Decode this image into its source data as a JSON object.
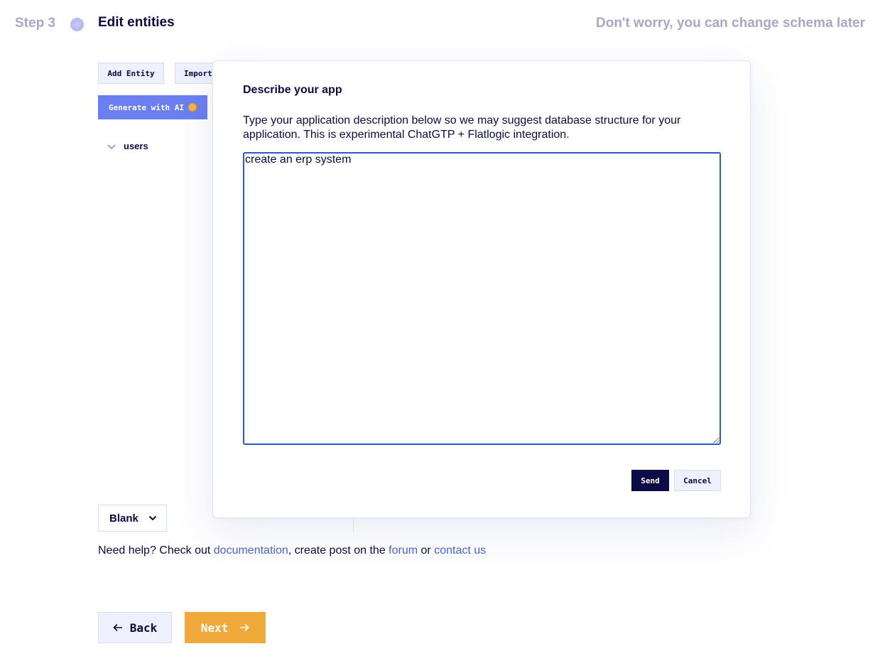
{
  "header": {
    "step": "Step 3",
    "title": "Edit entities",
    "hint": "Don't worry, you can change schema later"
  },
  "toolbar": {
    "add_entity": "Add Entity",
    "import": "Import",
    "generate_ai": "Generate with AI"
  },
  "entities": [
    {
      "label": "users",
      "expanded": false
    }
  ],
  "template_select": {
    "value": "Blank"
  },
  "help": {
    "prefix": "Need help? Check out ",
    "documentation": "documentation",
    "middle": ", create post on the ",
    "forum": "forum",
    "or": " or ",
    "contact": "contact us"
  },
  "nav": {
    "back": "Back",
    "next": "Next"
  },
  "modal": {
    "title": "Describe your app",
    "description": "Type your application description below so we may suggest database structure for your application. This is experimental ChatGTP + Flatlogic integration.",
    "textarea_value": "create an erp system",
    "send": "Send",
    "cancel": "Cancel"
  },
  "colors": {
    "primary_dark": "#0b0b45",
    "accent_blue": "#6b7ff0",
    "link": "#4a63e0",
    "next_orange": "#f2a93b",
    "muted": "#a7a8c6"
  }
}
